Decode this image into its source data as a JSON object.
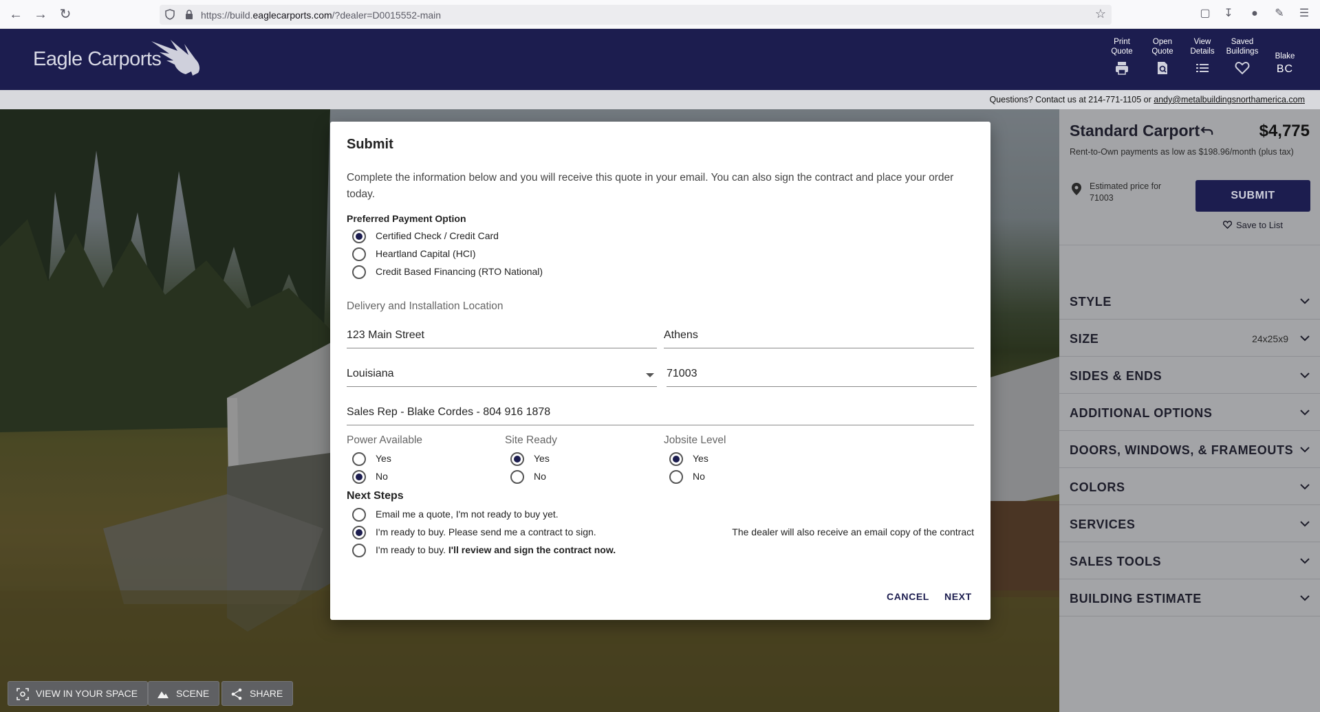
{
  "browser": {
    "url_prefix": "https://build.",
    "url_domain": "eaglecarports.com",
    "url_suffix": "/?dealer=D0015552-main"
  },
  "header": {
    "logo_text": "Eagle Carports",
    "items": [
      {
        "line1": "Print",
        "line2": "Quote"
      },
      {
        "line1": "Open",
        "line2": "Quote"
      },
      {
        "line1": "View",
        "line2": "Details"
      },
      {
        "line1": "Saved",
        "line2": "Buildings"
      }
    ],
    "user_name": "Blake",
    "user_initials": "BC"
  },
  "contact": {
    "text": "Questions? Contact us at 214-771-1105 or ",
    "email": "andy@metalbuildingsnorthamerica.com"
  },
  "scene_buttons": {
    "view_in_space": "VIEW IN YOUR SPACE",
    "scene": "SCENE",
    "share": "SHARE"
  },
  "sidebar": {
    "title": "Standard Carport",
    "price": "$4,775",
    "rto_text": "Rent-to-Own payments as low as $198.96/month (plus tax)",
    "estimate_line1": "Estimated price for",
    "estimate_zip": "71003",
    "submit_label": "SUBMIT",
    "save_label": "Save to List",
    "sections": [
      {
        "label": "STYLE",
        "value": ""
      },
      {
        "label": "SIZE",
        "value": "24x25x9"
      },
      {
        "label": "SIDES & ENDS",
        "value": ""
      },
      {
        "label": "ADDITIONAL OPTIONS",
        "value": ""
      },
      {
        "label": "DOORS, WINDOWS, & FRAMEOUTS",
        "value": ""
      },
      {
        "label": "COLORS",
        "value": ""
      },
      {
        "label": "SERVICES",
        "value": ""
      },
      {
        "label": "SALES TOOLS",
        "value": ""
      },
      {
        "label": "BUILDING ESTIMATE",
        "value": ""
      }
    ]
  },
  "modal": {
    "title": "Submit",
    "intro": "Complete the information below and you will receive this quote in your email. You can also sign the contract and place your order today.",
    "payment_label": "Preferred Payment Option",
    "payment_options": [
      {
        "label": "Certified Check / Credit Card",
        "selected": true
      },
      {
        "label": "Heartland Capital (HCI)",
        "selected": false
      },
      {
        "label": "Credit Based Financing (RTO National)",
        "selected": false
      }
    ],
    "delivery_label": "Delivery and Installation Location",
    "address": "123 Main Street",
    "city": "Athens",
    "state": "Louisiana",
    "zip": "71003",
    "sales_rep": "Sales Rep - Blake Cordes - 804 916 1878",
    "power_label": "Power Available",
    "power_yes": "Yes",
    "power_no": "No",
    "power_selected": "No",
    "site_label": "Site Ready",
    "site_yes": "Yes",
    "site_no": "No",
    "site_selected": "Yes",
    "jobsite_label": "Jobsite Level",
    "jobsite_yes": "Yes",
    "jobsite_no": "No",
    "jobsite_selected": "Yes",
    "next_steps_label": "Next Steps",
    "step1": "Email me a quote, I'm not ready to buy yet.",
    "step2": "I'm ready to buy. Please send me a contract to sign.",
    "step3_plain": "I'm ready to buy. ",
    "step3_bold": "I'll review and sign the contract now.",
    "step_selected": 2,
    "dealer_note": "The dealer will also receive an email copy of the contract",
    "cancel_label": "CANCEL",
    "next_label": "NEXT"
  },
  "colors": {
    "brand_navy": "#1c1d4f",
    "sidebar_bg": "#a3a4a7"
  }
}
